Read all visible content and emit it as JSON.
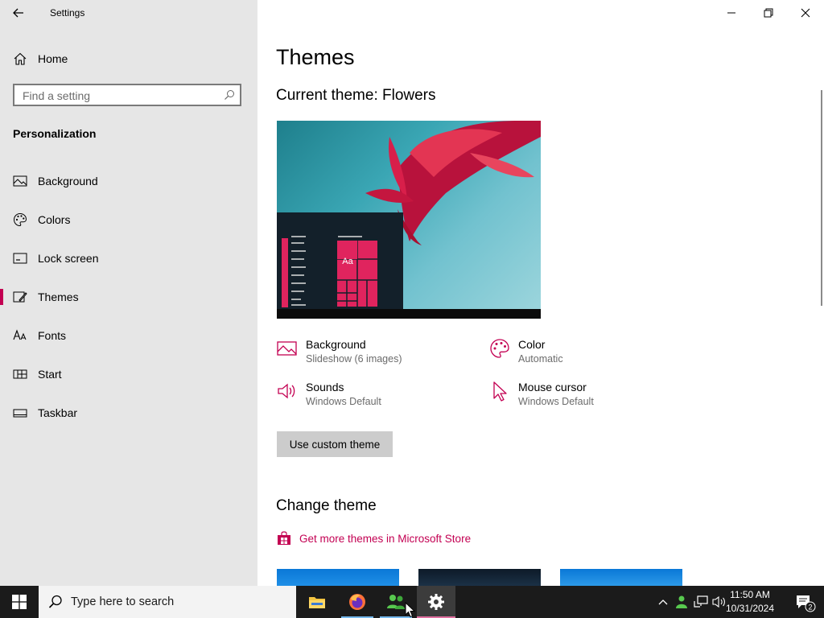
{
  "window": {
    "title": "Settings"
  },
  "sidebar": {
    "home_label": "Home",
    "search_placeholder": "Find a setting",
    "section_title": "Personalization",
    "items": [
      {
        "label": "Background",
        "icon": "picture-icon"
      },
      {
        "label": "Colors",
        "icon": "palette-icon"
      },
      {
        "label": "Lock screen",
        "icon": "lock-screen-icon"
      },
      {
        "label": "Themes",
        "icon": "themes-icon",
        "active": true
      },
      {
        "label": "Fonts",
        "icon": "fonts-icon"
      },
      {
        "label": "Start",
        "icon": "start-icon"
      },
      {
        "label": "Taskbar",
        "icon": "taskbar-icon"
      }
    ]
  },
  "main": {
    "page_title": "Themes",
    "current_theme": "Current theme: Flowers",
    "preview_tile_text": "Aa",
    "properties": {
      "background": {
        "name": "Background",
        "value": "Slideshow (6 images)"
      },
      "color": {
        "name": "Color",
        "value": "Automatic"
      },
      "sounds": {
        "name": "Sounds",
        "value": "Windows Default"
      },
      "mouse_cursor": {
        "name": "Mouse cursor",
        "value": "Windows Default"
      }
    },
    "custom_theme_button": "Use custom theme",
    "change_theme_heading": "Change theme",
    "store_link": "Get more themes in Microsoft Store"
  },
  "taskbar": {
    "search_placeholder": "Type here to search",
    "apps": [
      "file-explorer-icon",
      "firefox-icon",
      "people-app-icon",
      "settings-gear-icon"
    ],
    "time": "11:50 AM",
    "date": "10/31/2024",
    "notification_count": "2"
  },
  "colors": {
    "accent": "#c30052",
    "sidebar_bg": "#e6e6e6",
    "taskbar_bg": "#1b1b1b",
    "secondary_text": "#6b6b6b"
  }
}
